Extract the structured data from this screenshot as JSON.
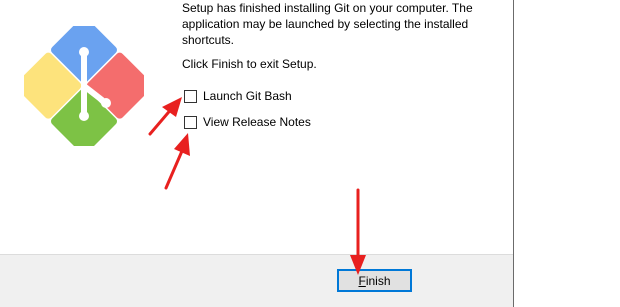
{
  "setup_message": {
    "lines": [
      "Setup has finished installing Git on your computer. The",
      "application may be launched by selecting the installed",
      "shortcuts."
    ],
    "finish_prompt": "Click Finish to exit Setup."
  },
  "options": [
    {
      "label": "Launch Git Bash",
      "checked": false
    },
    {
      "label": "View Release Notes",
      "checked": false
    }
  ],
  "footer": {
    "finish_button": {
      "mnemonic": "F",
      "rest": "inish"
    }
  },
  "logo": {
    "icon": "git-for-windows-logo",
    "colors": {
      "red": "#f46d6d",
      "green": "#7dc245",
      "yellow": "#fde37c",
      "blue": "#6aa2f0"
    }
  },
  "annotation_color": "#e8201f"
}
